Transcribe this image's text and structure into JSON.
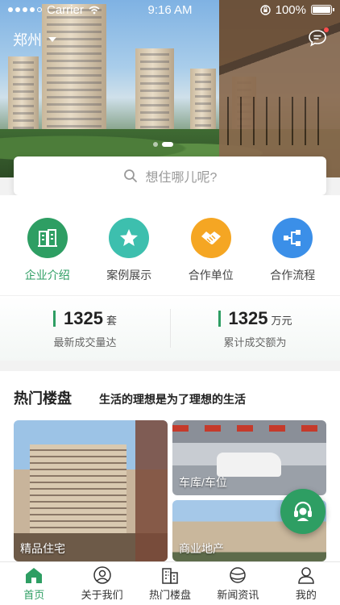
{
  "status_bar": {
    "carrier": "Carrier",
    "time": "9:16 AM",
    "battery": "100%"
  },
  "header": {
    "city": "郑州"
  },
  "banner": {
    "pages": 2,
    "current_page": 2
  },
  "search": {
    "placeholder": "想住哪儿呢?"
  },
  "quick_links": [
    {
      "label": "企业介绍",
      "icon": "building-icon",
      "color": "#2e9e63"
    },
    {
      "label": "案例展示",
      "icon": "star-icon",
      "color": "#3dbfae"
    },
    {
      "label": "合作单位",
      "icon": "handshake-icon",
      "color": "#f5a623"
    },
    {
      "label": "合作流程",
      "icon": "flow-icon",
      "color": "#3b8fe8"
    }
  ],
  "stats": [
    {
      "value": "1325",
      "unit": "套",
      "label": "最新成交量达"
    },
    {
      "value": "1325",
      "unit": "万元",
      "label": "累计成交额为"
    }
  ],
  "hot": {
    "title": "热门楼盘",
    "slogan": "生活的理想是为了理想的生活",
    "cards": [
      {
        "tag": "精品住宅"
      },
      {
        "tag": "车库/车位"
      },
      {
        "tag": "商业地产"
      }
    ]
  },
  "tabbar": [
    {
      "label": "首页",
      "icon": "home-icon"
    },
    {
      "label": "关于我们",
      "icon": "user-circle-icon"
    },
    {
      "label": "热门楼盘",
      "icon": "buildings-icon"
    },
    {
      "label": "新闻资讯",
      "icon": "globe-icon"
    },
    {
      "label": "我的",
      "icon": "profile-icon"
    }
  ],
  "colors": {
    "brand": "#2e9e63"
  }
}
